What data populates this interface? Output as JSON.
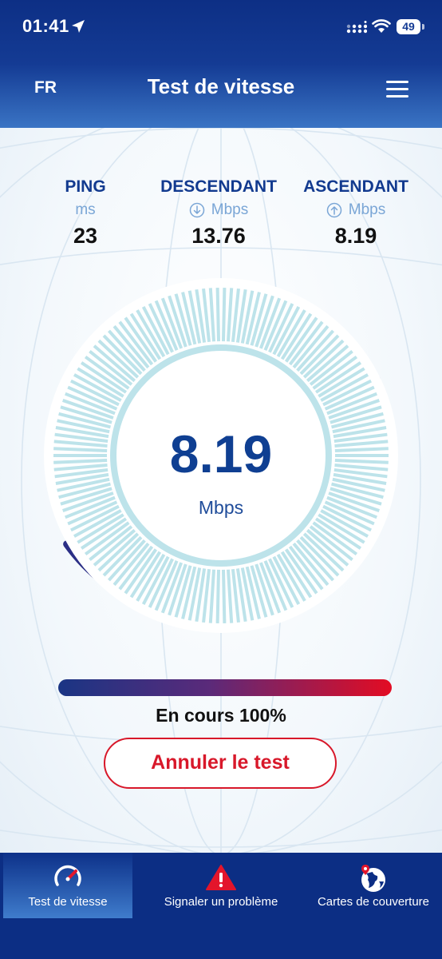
{
  "status_bar": {
    "time": "01:41",
    "battery": "49"
  },
  "header": {
    "language": "FR",
    "title": "Test de vitesse",
    "menu_icon": "hamburger-icon"
  },
  "stats": {
    "ping": {
      "label": "PING",
      "unit": "ms",
      "value": "23"
    },
    "download": {
      "label": "DESCENDANT",
      "unit": "Mbps",
      "value": "13.76",
      "icon": "arrow-down-circle-icon"
    },
    "upload": {
      "label": "ASCENDANT",
      "unit": "Mbps",
      "value": "8.19",
      "icon": "arrow-up-circle-icon"
    }
  },
  "gauge": {
    "value": "8.19",
    "unit": "Mbps"
  },
  "progress": {
    "text": "En cours 100%",
    "percent": 100
  },
  "cancel_label": "Annuler le test",
  "tabs": [
    {
      "label": "Test de vitesse",
      "icon": "speedometer-icon",
      "active": true
    },
    {
      "label": "Signaler un problème",
      "icon": "warning-icon",
      "active": false
    },
    {
      "label": "Cartes de couverture",
      "icon": "globe-pin-icon",
      "active": false
    }
  ],
  "colors": {
    "primary": "#0c2e84",
    "accent_red": "#d8182a",
    "light_blue": "#7aa6d6",
    "gauge_ticks": "#bde3ea"
  }
}
